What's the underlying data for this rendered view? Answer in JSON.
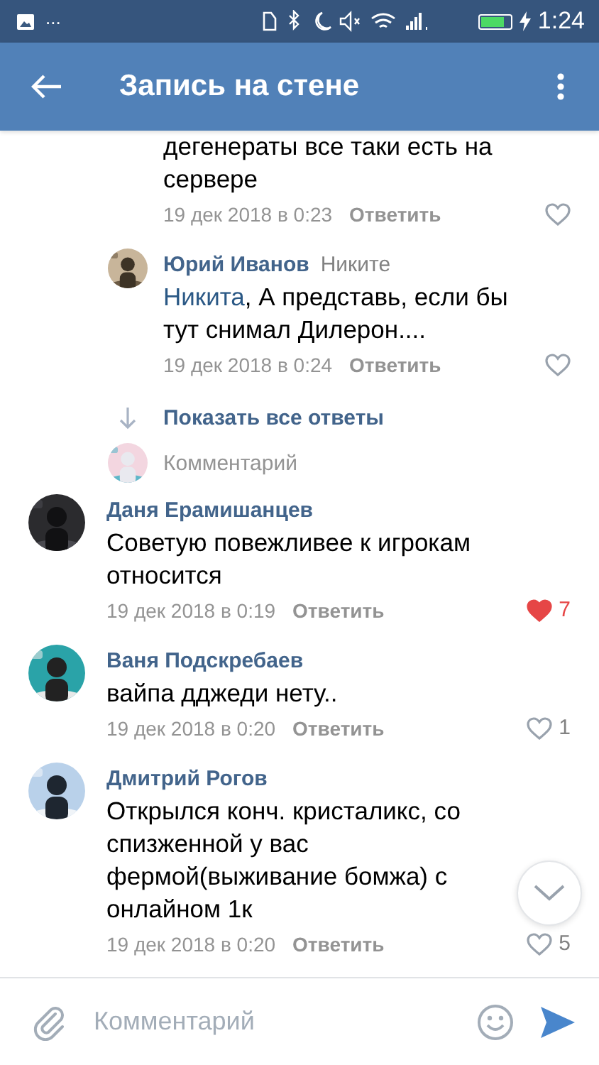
{
  "status_bar": {
    "notifications": "...",
    "time": "1:24"
  },
  "header": {
    "title": "Запись на стене"
  },
  "items": [
    {
      "kind": "reply",
      "text": "дегенераты все таки есть на сервере",
      "date": "19 дек 2018 в 0:23",
      "reply_label": "Ответить",
      "liked": false
    },
    {
      "kind": "reply",
      "author": "Юрий Иванов",
      "to": "Никите",
      "mention": "Никита",
      "text": ", А представь, если бы тут снимал Дилерон....",
      "date": "19 дек 2018 в 0:24",
      "reply_label": "Ответить",
      "liked": false
    },
    {
      "kind": "show_more",
      "label": "Показать все ответы"
    },
    {
      "kind": "reply_input",
      "placeholder": "Комментарий"
    },
    {
      "kind": "comment",
      "author": "Даня Ерамишанцев",
      "text": "Советую повежливее к игрокам относится",
      "date": "19 дек 2018 в 0:19",
      "reply_label": "Ответить",
      "liked": true,
      "likes": "7"
    },
    {
      "kind": "comment",
      "author": "Ваня Подскребаев",
      "text": "вайпа дджеди нету..",
      "date": "19 дек 2018 в 0:20",
      "reply_label": "Ответить",
      "liked": false,
      "likes": "1"
    },
    {
      "kind": "comment",
      "author": "Дмитрий Рогов",
      "text": "Открылся конч. кристаликс, со спизженной у вас фермой(выживание бомжа) с онлайном 1к",
      "date": "19 дек 2018 в 0:20",
      "reply_label": "Ответить",
      "liked": false,
      "likes": "5"
    }
  ],
  "composer": {
    "placeholder": "Комментарий"
  }
}
